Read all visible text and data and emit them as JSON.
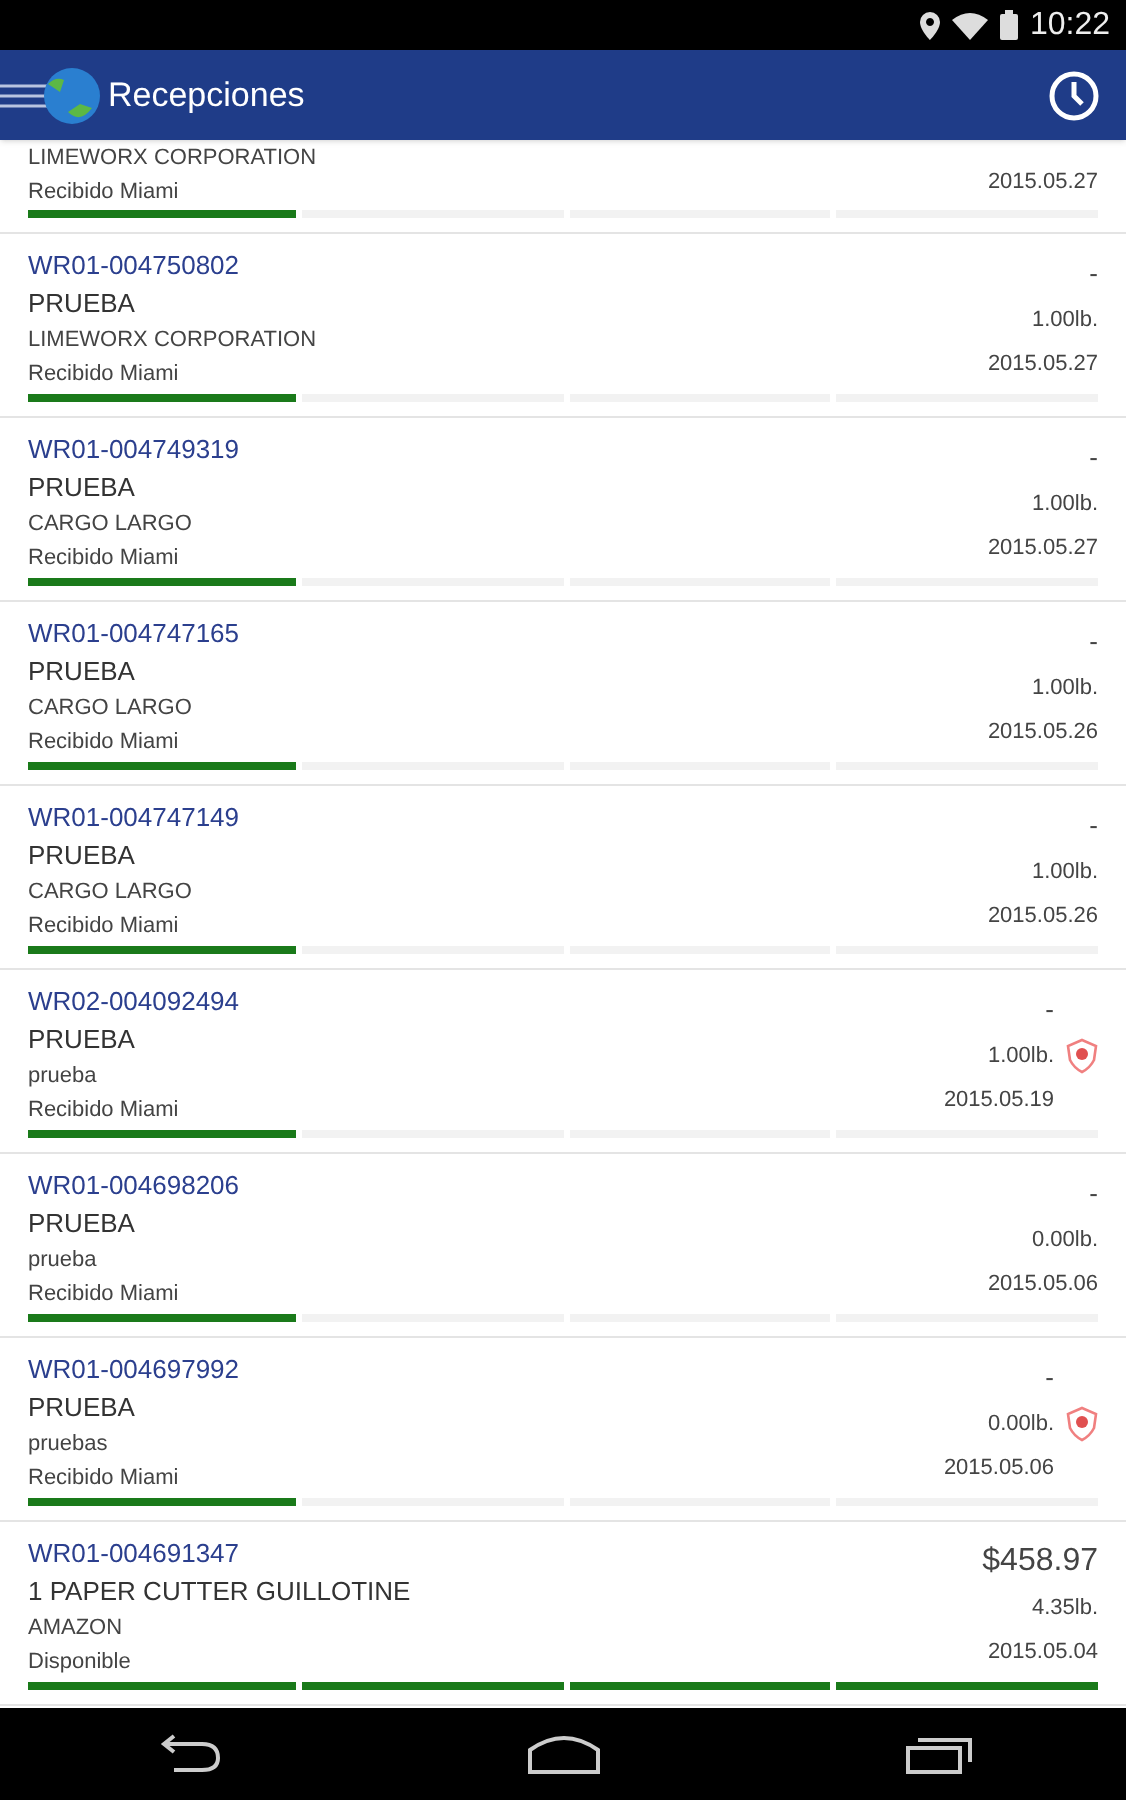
{
  "status_bar": {
    "time": "10:22"
  },
  "app_bar": {
    "title": "Recepciones"
  },
  "rows": [
    {
      "company": "LIMEWORX CORPORATION",
      "status": "Recibido  Miami",
      "date": "2015.05.27",
      "flagged": false,
      "level": 0.25
    },
    {
      "id": "WR01-004750802",
      "description": "PRUEBA",
      "company": "LIMEWORX CORPORATION",
      "status": "Recibido  Miami",
      "amount": "-",
      "weight": "1.00lb.",
      "date": "2015.05.27",
      "flagged": false,
      "level": 0.25
    },
    {
      "id": "WR01-004749319",
      "description": "PRUEBA",
      "company": "CARGO LARGO",
      "status": "Recibido  Miami",
      "amount": "-",
      "weight": "1.00lb.",
      "date": "2015.05.27",
      "flagged": false,
      "level": 0.25
    },
    {
      "id": "WR01-004747165",
      "description": "PRUEBA",
      "company": "CARGO LARGO",
      "status": "Recibido  Miami",
      "amount": "-",
      "weight": "1.00lb.",
      "date": "2015.05.26",
      "flagged": false,
      "level": 0.25
    },
    {
      "id": "WR01-004747149",
      "description": "PRUEBA",
      "company": "CARGO LARGO",
      "status": "Recibido  Miami",
      "amount": "-",
      "weight": "1.00lb.",
      "date": "2015.05.26",
      "flagged": false,
      "level": 0.25
    },
    {
      "id": "WR02-004092494",
      "description": "PRUEBA",
      "company": "prueba",
      "status": "Recibido  Miami",
      "amount": "-",
      "weight": "1.00lb.",
      "date": "2015.05.19",
      "flagged": true,
      "level": 0.25
    },
    {
      "id": "WR01-004698206",
      "description": "PRUEBA",
      "company": "prueba",
      "status": "Recibido  Miami",
      "amount": "-",
      "weight": "0.00lb.",
      "date": "2015.05.06",
      "flagged": false,
      "level": 0.25
    },
    {
      "id": "WR01-004697992",
      "description": "PRUEBA",
      "company": "pruebas",
      "status": "Recibido  Miami",
      "amount": "-",
      "weight": "0.00lb.",
      "date": "2015.05.06",
      "flagged": true,
      "level": 0.25
    },
    {
      "id": "WR01-004691347",
      "description": "1 PAPER CUTTER GUILLOTINE",
      "company": "AMAZON",
      "status": "Disponible",
      "amount": "$458.97",
      "weight": "4.35lb.",
      "date": "2015.05.04",
      "flagged": false,
      "level": 1
    }
  ]
}
